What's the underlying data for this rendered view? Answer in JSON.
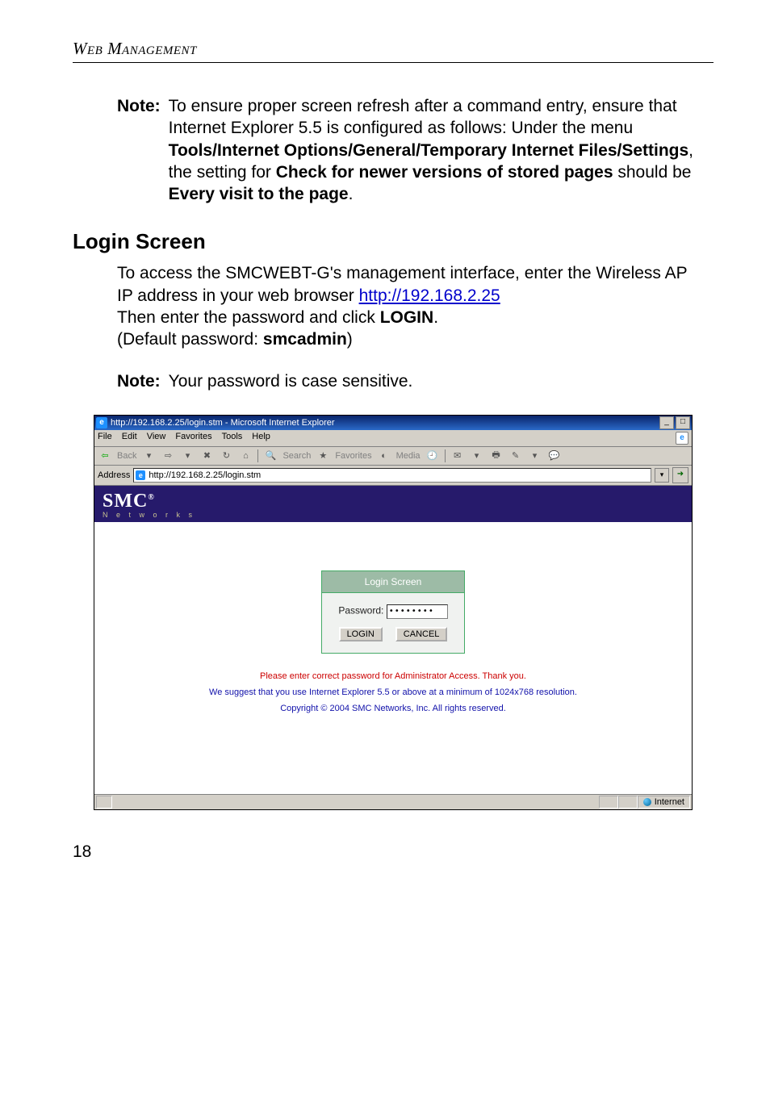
{
  "running_head": "Web Management",
  "note1": {
    "label": "Note:",
    "text_parts": {
      "a": "To ensure proper screen refresh after a command entry, ensure that Internet Explorer 5.5 is configured as follows: Under the menu ",
      "b": "Tools/Internet Options/General/Temporary Internet Files/Settings",
      "c": ", the setting for ",
      "d": "Check for newer versions of stored pages",
      "e": " should be ",
      "f": "Every visit to the page",
      "g": "."
    }
  },
  "section_heading": "Login Screen",
  "body": {
    "p1a": "To access the SMCWEBT-G's management interface, enter the Wireless AP IP address in your web browser ",
    "p1_link_text": "http://192.168.2.25",
    "p1_link_href": "http://192.168.2.25",
    "p2a": "Then enter the password and click ",
    "p2b": "LOGIN",
    "p2c": ".",
    "p3a": "(Default password: ",
    "p3b": "smcadmin",
    "p3c": ")"
  },
  "note2": {
    "label": "Note:",
    "text": "Your password is case sensitive."
  },
  "ie": {
    "title": "http://192.168.2.25/login.stm - Microsoft Internet Explorer",
    "menu": {
      "file": "File",
      "edit": "Edit",
      "view": "View",
      "favorites": "Favorites",
      "tools": "Tools",
      "help": "Help"
    },
    "toolbar": {
      "back": "Back",
      "search": "Search",
      "favorites": "Favorites",
      "media": "Media"
    },
    "address_label": "Address",
    "address_value": "http://192.168.2.25/login.stm",
    "smc": {
      "brand": "SMC",
      "reg": "®",
      "sub": "N e t w o r k s"
    },
    "login": {
      "header": "Login Screen",
      "password_label": "Password:",
      "password_value": "••••••••",
      "login_btn": "LOGIN",
      "cancel_btn": "CANCEL"
    },
    "messages": {
      "red": "Please enter correct password for Administrator Access. Thank you.",
      "blue1": "We suggest that you use Internet Explorer 5.5 or above at a minimum of 1024x768 resolution.",
      "blue2": "Copyright © 2004 SMC Networks, Inc. All rights reserved."
    },
    "status": {
      "zone": "Internet"
    },
    "win_btns": {
      "min": "_",
      "max": "□",
      "close": "×"
    }
  },
  "page_number": "18"
}
